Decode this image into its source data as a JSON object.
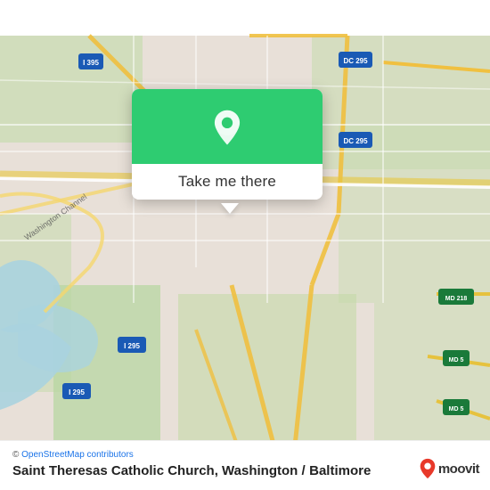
{
  "map": {
    "alt": "Map of Washington DC area showing Saint Theresas Catholic Church"
  },
  "popup": {
    "button_label": "Take me there",
    "pin_icon": "location-pin"
  },
  "bottom_bar": {
    "osm_credit": "© OpenStreetMap contributors",
    "location_name": "Saint Theresas Catholic Church, Washington /",
    "location_sub": "Baltimore"
  },
  "moovit": {
    "logo_text": "moovit"
  },
  "colors": {
    "green": "#2ecc71",
    "map_bg": "#e8e0d8",
    "road_yellow": "#f5d76e",
    "road_white": "#ffffff",
    "water": "#aad3df",
    "green_area": "#b5d29e"
  }
}
